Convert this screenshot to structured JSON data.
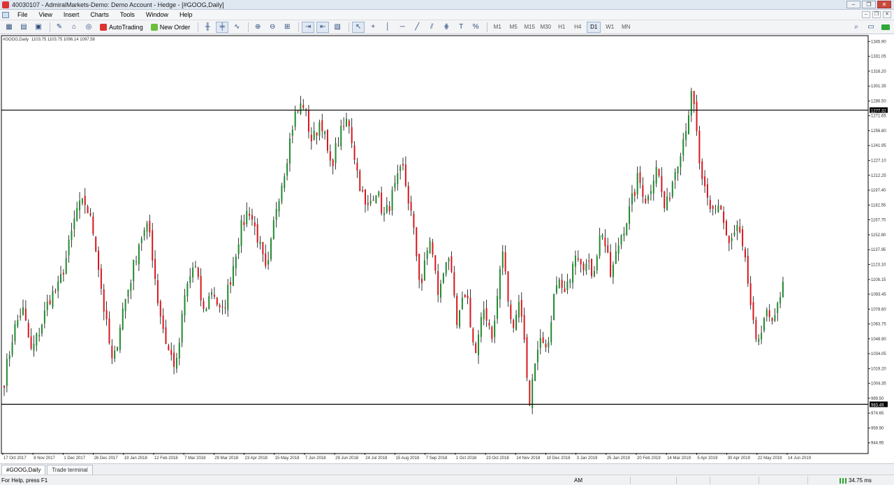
{
  "window": {
    "title": "40030107 - AdmiralMarkets-Demo: Demo Account - Hedge - [#GOOG,Daily]",
    "buttons": [
      "–",
      "❐",
      "✕"
    ]
  },
  "menu": {
    "items": [
      "File",
      "View",
      "Insert",
      "Charts",
      "Tools",
      "Window",
      "Help"
    ]
  },
  "toolbar": {
    "autotrading_label": "AutoTrading",
    "neworder_label": "New Order",
    "timeframes": [
      "M1",
      "M5",
      "M15",
      "M30",
      "H1",
      "H4",
      "D1",
      "W1",
      "MN"
    ],
    "active_timeframe": "D1"
  },
  "chart_header": {
    "symbol": "#GOOG,Daily",
    "ohlc": "1103.75 1103.75 1096.14 1097.58"
  },
  "chart_data": {
    "type": "candlestick",
    "symbol": "#GOOG",
    "period": "Daily",
    "ylim": [
      935,
      1351
    ],
    "y_ticks": [
      944.95,
      959.9,
      974.65,
      989.5,
      1004.35,
      1019.2,
      1034.05,
      1048.9,
      1063.75,
      1078.6,
      1093.45,
      1108.15,
      1123.1,
      1137.95,
      1152.8,
      1167.7,
      1182.55,
      1197.4,
      1212.25,
      1227.1,
      1241.95,
      1256.8,
      1271.65,
      1286.5,
      1301.35,
      1316.2,
      1331.05,
      1345.9
    ],
    "x_ticks": [
      "17 Oct 2017",
      "8 Nov 2017",
      "1 Dec 2017",
      "26 Dec 2017",
      "19 Jan 2018",
      "12 Feb 2018",
      "7 Mar 2018",
      "29 Mar 2018",
      "23 Apr 2018",
      "15 May 2018",
      "7 Jun 2018",
      "29 Jun 2018",
      "24 Jul 2018",
      "15 Aug 2018",
      "7 Sep 2018",
      "1 Oct 2018",
      "23 Oct 2018",
      "14 Nov 2018",
      "10 Dec 2018",
      "3 Jan 2019",
      "25 Jan 2019",
      "20 Feb 2019",
      "14 Mar 2019",
      "5 Apr 2019",
      "30 Apr 2019",
      "22 May 2019",
      "14 Jun 2019"
    ],
    "horizontal_lines": [
      {
        "price": 1277.32,
        "label": "1277.32"
      },
      {
        "price": 983.49,
        "label": "983.49"
      }
    ],
    "anchors": [
      1008,
      1055,
      1080,
      1035,
      1060,
      1090,
      1100,
      1135,
      1178,
      1185,
      1150,
      1080,
      1020,
      1075,
      1110,
      1150,
      1160,
      1085,
      1040,
      1020,
      1095,
      1125,
      1075,
      1100,
      1070,
      1110,
      1155,
      1180,
      1150,
      1110,
      1180,
      1220,
      1270,
      1285,
      1245,
      1270,
      1220,
      1250,
      1270,
      1215,
      1175,
      1200,
      1170,
      1195,
      1220,
      1170,
      1100,
      1150,
      1090,
      1140,
      1060,
      1100,
      1030,
      1080,
      1050,
      1140,
      1060,
      1090,
      985,
      1050,
      1030,
      1110,
      1090,
      1140,
      1125,
      1115,
      1160,
      1110,
      1150,
      1175,
      1210,
      1185,
      1225,
      1175,
      1215,
      1250,
      1295,
      1205,
      1175,
      1185,
      1140,
      1160,
      1115,
      1040,
      1075,
      1060,
      1110
    ]
  },
  "tabs": [
    "#GOOG,Daily",
    "Trade terminal"
  ],
  "status": {
    "help": "For Help, press F1",
    "session": "AM",
    "ping": "34.75 ms"
  }
}
